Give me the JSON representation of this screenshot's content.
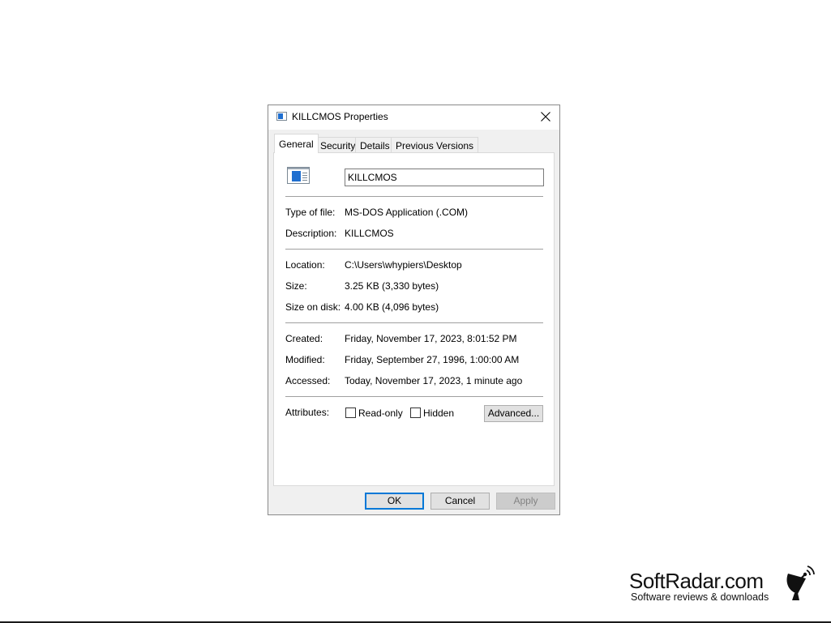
{
  "window": {
    "title": "KILLCMOS Properties",
    "icon": "ms-dos-app-icon"
  },
  "tabs": [
    {
      "label": "General",
      "active": true
    },
    {
      "label": "Security",
      "active": false
    },
    {
      "label": "Details",
      "active": false
    },
    {
      "label": "Previous Versions",
      "active": false
    }
  ],
  "general": {
    "file_name": "KILLCMOS",
    "type_label": "Type of file:",
    "type_value": "MS-DOS Application (.COM)",
    "description_label": "Description:",
    "description_value": "KILLCMOS",
    "location_label": "Location:",
    "location_value": "C:\\Users\\whypiers\\Desktop",
    "size_label": "Size:",
    "size_value": "3.25 KB (3,330 bytes)",
    "size_on_disk_label": "Size on disk:",
    "size_on_disk_value": "4.00 KB (4,096 bytes)",
    "created_label": "Created:",
    "created_value": "Friday, November 17, 2023, 8:01:52 PM",
    "modified_label": "Modified:",
    "modified_value": "Friday, September 27, 1996, 1:00:00 AM",
    "accessed_label": "Accessed:",
    "accessed_value": "Today, November 17, 2023, 1 minute ago",
    "attributes_label": "Attributes:",
    "readonly_label": "Read-only",
    "readonly_checked": false,
    "hidden_label": "Hidden",
    "hidden_checked": false,
    "advanced_label": "Advanced..."
  },
  "buttons": {
    "ok": "OK",
    "cancel": "Cancel",
    "apply": "Apply"
  },
  "watermark": {
    "name": "SoftRadar.com",
    "tagline": "Software reviews & downloads"
  },
  "colors": {
    "accent": "#0078d7",
    "icon_blue": "#1f6fd0"
  }
}
